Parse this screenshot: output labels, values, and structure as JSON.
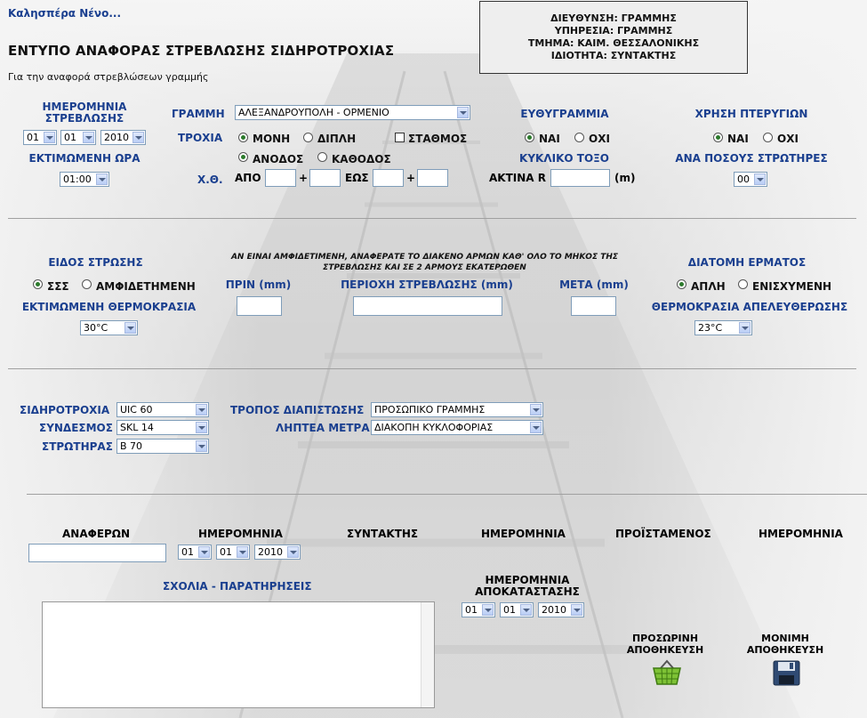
{
  "header": {
    "greeting": "Καλησπέρα Νένο...",
    "title": "ΕΝΤΥΠΟ ΑΝΑΦΟΡΑΣ ΣΤΡΕΒΛΩΣΗΣ ΣΙΔΗΡΟΤΡΟΧΙΑΣ",
    "subtitle": "Για την αναφορά στρεβλώσεων γραμμής"
  },
  "info": {
    "line1": "ΔΙΕΥΘΥΝΣΗ: ΓΡΑΜΜΗΣ",
    "line2": "ΥΠΗΡΕΣΙΑ: ΓΡΑΜΜΗΣ",
    "line3": "ΤΜΗΜΑ: ΚΑΙΜ. ΘΕΣΣΑΛΟΝΙΚΗΣ",
    "line4": "ΙΔΙΟΤΗΤΑ: ΣΥΝΤΑΚΤΗΣ"
  },
  "section1": {
    "date_label": "ΗΜΕΡΟΜΗΝΙΑ ΣΤΡΕΒΛΩΣΗΣ",
    "day": "01",
    "month": "01",
    "year": "2010",
    "time_label": "ΕΚΤΙΜΩΜΕΝΗ ΩΡΑ",
    "time": "01:00",
    "line_label": "ΓΡΑΜΜΗ",
    "line_value": "ΑΛΕΞΑΝΔΡΟΥΠΟΛΗ - ΟΡΜΕΝΙΟ",
    "track_label": "ΤΡΟΧΙΑ",
    "single": "ΜΟΝΗ",
    "double": "ΔΙΠΛΗ",
    "station": "ΣΤΑΘΜΟΣ",
    "up": "ΑΝΟΔΟΣ",
    "down": "ΚΑΘΟΔΟΣ",
    "chainage_label": "Χ.Θ.",
    "from": "ΑΠΟ",
    "plus": "+",
    "to": "ΕΩΣ",
    "straight_label": "ΕΥΘΥΓΡΑΜΜΙΑ",
    "yes": "ΝΑΙ",
    "no": "ΟΧΙ",
    "curve_label": "ΚΥΚΛΙΚΟ ΤΟΞΟ",
    "radius_label": "ΑΚΤΙΝΑ R",
    "radius_unit": "(m)",
    "wings_label": "ΧΡΗΣΗ ΠΤΕΡΥΓΙΩΝ",
    "sleepers_label": "ΑΝΑ ΠΟΣΟΥΣ ΣΤΡΩΤΗΡΕΣ",
    "sleepers": "00"
  },
  "section2": {
    "note": "ΑΝ ΕΙΝΑΙ ΑΜΦΙΔΕΤΙΜΕΝΗ, ΑΝΑΦΕΡΑΤΕ ΤΟ ΔΙΑΚΕΝΟ ΑΡΜΩΝ ΚΑΘ' ΟΛΟ ΤΟ ΜΗΚΟΣ ΤΗΣ ΣΤΡΕΒΛΩΣΗΣ ΚΑΙ ΣΕ 2 ΑΡΜΟΥΣ ΕΚΑΤΕΡΩΘΕΝ",
    "type_label": "ΕΙΔΟΣ ΣΤΡΩΣΗΣ",
    "sss": "ΣΣΣ",
    "amfi": "ΑΜΦΙΔΕΤΗΜΕΝΗ",
    "temp_label": "ΕΚΤΙΜΩΜΕΝΗ ΘΕΡΜΟΚΡΑΣΙΑ",
    "temp": "30°C",
    "before_label": "ΠΡΙΝ (mm)",
    "area_label": "ΠΕΡΙΟΧΗ ΣΤΡΕΒΛΩΣΗΣ (mm)",
    "after_label": "ΜΕΤΑ (mm)",
    "ballast_label": "ΔΙΑΤΟΜΗ ΕΡΜΑΤΟΣ",
    "simple": "ΑΠΛΗ",
    "reinforced": "ΕΝΙΣΧΥΜΕΝΗ",
    "release_label": "ΘΕΡΜΟΚΡΑΣΙΑ ΑΠΕΛΕΥΘΕΡΩΣΗΣ",
    "release": "23°C"
  },
  "section3": {
    "rail_label": "ΣΙΔΗΡΟΤΡΟΧΙΑ",
    "rail": "UIC 60",
    "fastening_label": "ΣΥΝΔΕΣΜΟΣ",
    "fastening": "SKL 14",
    "sleeper_label": "ΣΤΡΩΤΗΡΑΣ",
    "sleeper": "B 70",
    "detection_label": "ΤΡΟΠΟΣ ΔΙΑΠΙΣΤΩΣΗΣ",
    "detection": "ΠΡΟΣΩΠΙΚΟ ΓΡΑΜΜΗΣ",
    "measures_label": "ΛΗΠΤΕΑ ΜΕΤΡΑ",
    "measures": "ΔΙΑΚΟΠΗ ΚΥΚΛΟΦΟΡΙΑΣ"
  },
  "section4": {
    "reporter_label": "ΑΝΑΦΕΡΩΝ",
    "date_label": "ΗΜΕΡΟΜΗΝΙΑ",
    "day": "01",
    "month": "01",
    "year": "2010",
    "author_label": "ΣΥΝΤΑΚΤΗΣ",
    "date2_label": "ΗΜΕΡΟΜΗΝΙΑ",
    "supervisor_label": "ΠΡΟΪΣΤΑΜΕΝΟΣ",
    "date3_label": "ΗΜΕΡΟΜΗΝΙΑ",
    "comments_label": "ΣΧΟΛΙΑ - ΠΑΡΑΤΗΡΗΣΕΙΣ",
    "restore_label": "ΗΜΕΡΟΜΗΝΙΑ ΑΠΟΚΑΤΑΣΤΑΣΗΣ",
    "r_day": "01",
    "r_month": "01",
    "r_year": "2010",
    "temp_save": "ΠΡΟΣΩΡΙΝΗ ΑΠΟΘΗΚΕΥΣΗ",
    "perm_save": "ΜΟΝΙΜΗ ΑΠΟΘΗΚΕΥΣΗ"
  }
}
